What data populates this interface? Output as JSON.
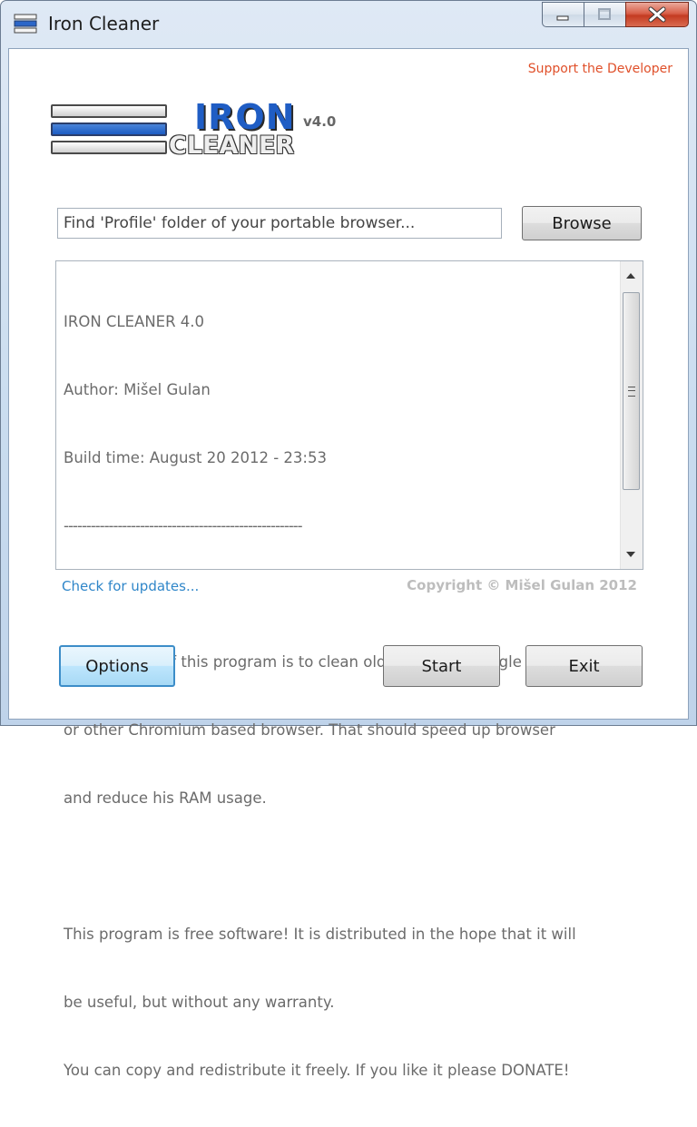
{
  "window": {
    "title": "Iron Cleaner",
    "caption_buttons": [
      "minimize",
      "maximize",
      "close"
    ]
  },
  "header": {
    "support_link": "Support the Developer"
  },
  "logo": {
    "word1": "IRON",
    "word2": "CLEANER",
    "version": "v4.0"
  },
  "path_field": {
    "value": "",
    "placeholder": "Find 'Profile' folder of your portable browser..."
  },
  "buttons": {
    "browse": "Browse",
    "options": "Options",
    "start": "Start",
    "exit": "Exit"
  },
  "log": {
    "lines": [
      "IRON CLEANER 4.0",
      "Author: Mišel Gulan",
      "Build time: August 20 2012 - 23:53",
      "-----------------------------------------------------",
      "",
      "The purpose of this program is to clean old data from Google Chrome",
      "or other Chromium based browser. That should speed up browser",
      "and reduce his RAM usage.",
      "",
      "This program is free software! It is distributed in the hope that it will",
      "be useful, but without any warranty.",
      "You can copy and redistribute it freely. If you like it please DONATE!"
    ]
  },
  "footer": {
    "update_link": "Check for updates...",
    "copyright": "Copyright © Mišel Gulan 2012"
  },
  "colors": {
    "support_link": "#e0502a",
    "update_link": "#2f86c9",
    "logo_blue": "#1f5dc4"
  }
}
